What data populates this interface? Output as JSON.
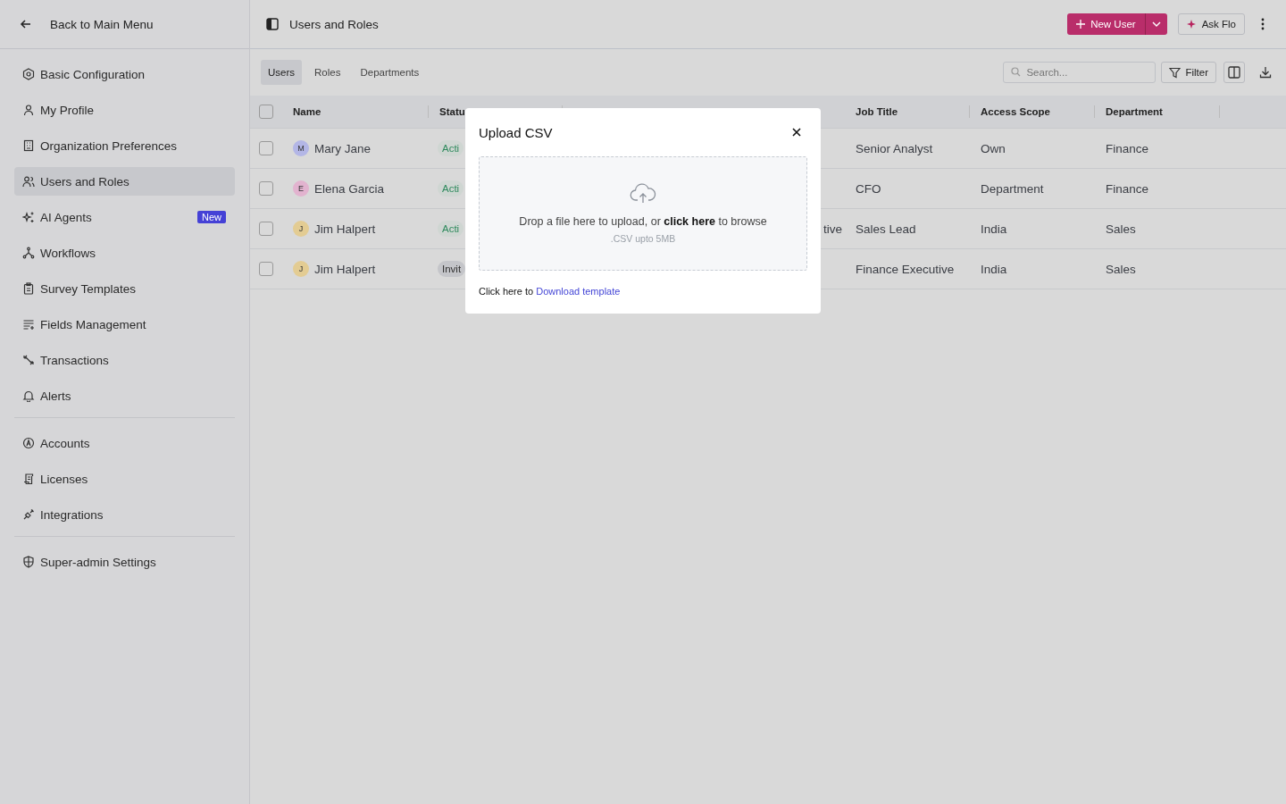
{
  "sidebar": {
    "back": "Back to Main Menu",
    "groups": [
      [
        {
          "label": "Basic Configuration",
          "kind": "hexagon",
          "selected": false
        },
        {
          "label": "My Profile",
          "kind": "user",
          "selected": false
        },
        {
          "label": "Organization Preferences",
          "kind": "building",
          "selected": false
        },
        {
          "label": "Users and Roles",
          "kind": "users",
          "selected": true
        },
        {
          "label": "AI Agents",
          "kind": "sparkle",
          "selected": false,
          "badge": "New"
        },
        {
          "label": "Workflows",
          "kind": "flow",
          "selected": false
        },
        {
          "label": "Survey Templates",
          "kind": "clipboard",
          "selected": false
        },
        {
          "label": "Fields Management",
          "kind": "lines",
          "selected": false
        },
        {
          "label": "Transactions",
          "kind": "arrows",
          "selected": false
        },
        {
          "label": "Alerts",
          "kind": "bell",
          "selected": false
        }
      ],
      [
        {
          "label": "Accounts",
          "kind": "circle-a",
          "selected": false
        },
        {
          "label": "Licenses",
          "kind": "scroll",
          "selected": false
        },
        {
          "label": "Integrations",
          "kind": "plug",
          "selected": false
        }
      ],
      [
        {
          "label": "Super-admin Settings",
          "kind": "shield",
          "selected": false
        }
      ]
    ]
  },
  "header": {
    "title": "Users and Roles",
    "new_user": "New User",
    "ask": "Ask Flo"
  },
  "tabs": [
    {
      "label": "Users",
      "selected": true
    },
    {
      "label": "Roles",
      "selected": false
    },
    {
      "label": "Departments",
      "selected": false
    }
  ],
  "search": {
    "placeholder": "Search..."
  },
  "filter": "Filter",
  "table": {
    "all_checked": false,
    "columns": [
      "Name",
      "Statu",
      "",
      "Job Title",
      "Access Scope",
      "Department"
    ],
    "rows": [
      {
        "initial": "M",
        "color": "#b3b6e6",
        "name": "Mary Jane",
        "checked": false,
        "status": "Acti",
        "kind": "active",
        "column_3": "",
        "job": "Senior Analyst",
        "scope": "Own",
        "dept": "Finance"
      },
      {
        "initial": "E",
        "color": "#e2b3cf",
        "name": "Elena Garcia",
        "checked": false,
        "status": "Acti",
        "kind": "active",
        "column_3": "",
        "job": "CFO",
        "scope": "Department",
        "dept": "Finance"
      },
      {
        "initial": "J",
        "color": "#e3cc93",
        "name": "Jim Halpert",
        "checked": false,
        "status": "Acti",
        "kind": "active",
        "column_3": "tive",
        "job": "Sales Lead",
        "scope": "India",
        "dept": "Sales"
      },
      {
        "initial": "J",
        "color": "#e3cc93",
        "name": "Jim Halpert",
        "checked": false,
        "status": "Invit",
        "kind": "invited",
        "column_3": "",
        "job": "Finance Executive",
        "scope": "India",
        "dept": "Sales"
      }
    ]
  },
  "modal": {
    "title": "Upload CSV",
    "drop": "Drop a file here to upload, or **click here** to browse",
    "hint": ".CSV upto 5MB",
    "footer": "Click here to",
    "link": "Download template"
  }
}
